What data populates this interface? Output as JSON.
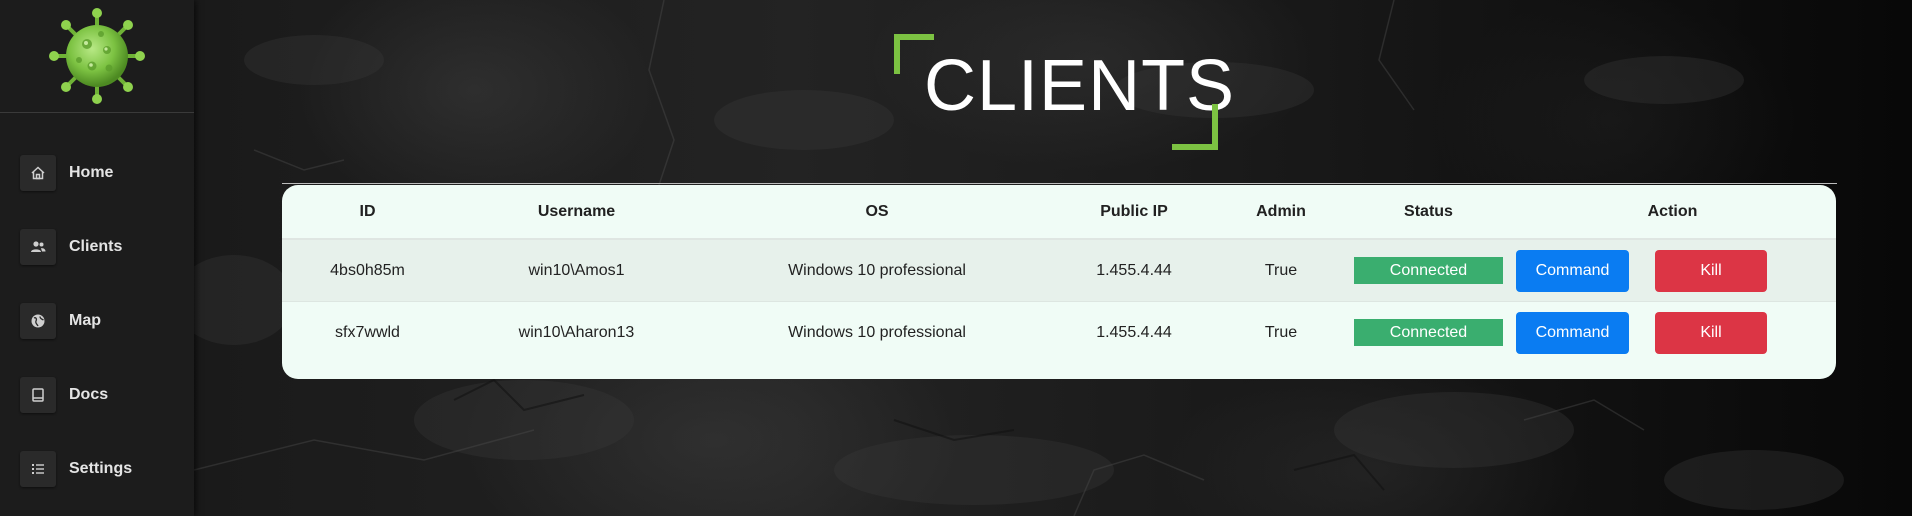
{
  "brand": {
    "logo_icon": "virus-icon",
    "accent_color": "#7cc242"
  },
  "sidebar": {
    "items": [
      {
        "label": "Home",
        "icon": "home-icon"
      },
      {
        "label": "Clients",
        "icon": "users-icon"
      },
      {
        "label": "Map",
        "icon": "globe-icon"
      },
      {
        "label": "Docs",
        "icon": "book-icon"
      },
      {
        "label": "Settings",
        "icon": "list-icon"
      }
    ]
  },
  "main": {
    "title": "CLIENTS",
    "table": {
      "columns": [
        "ID",
        "Username",
        "OS",
        "Public IP",
        "Admin",
        "Status",
        "Action"
      ],
      "rows": [
        {
          "id": "4bs0h85m",
          "username": "win10\\Amos1",
          "os": "Windows 10 professional",
          "public_ip": "1.455.4.44",
          "admin": "True",
          "status": "Connected",
          "command_label": "Command",
          "kill_label": "Kill"
        },
        {
          "id": "sfx7wwld",
          "username": "win10\\Aharon13",
          "os": "Windows 10 professional",
          "public_ip": "1.455.4.44",
          "admin": "True",
          "status": "Connected",
          "command_label": "Command",
          "kill_label": "Kill"
        }
      ]
    },
    "colors": {
      "status_connected": "#3aae6f",
      "command_button": "#0a7cf2",
      "kill_button": "#dc3545"
    }
  }
}
